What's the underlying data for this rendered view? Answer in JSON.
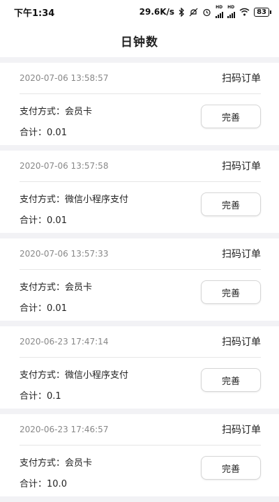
{
  "status_bar": {
    "time": "下午1:34",
    "net_speed": "29.6K/s",
    "battery": "83",
    "hd1": "HD",
    "hd2": "HD"
  },
  "header": {
    "title": "日钟数"
  },
  "orders": [
    {
      "time": "2020-07-06 13:58:57",
      "type": "扫码订单",
      "pay_label": "支付方式：",
      "pay_method": "会员卡",
      "total_label": "合计：",
      "total": "0.01",
      "action": "完善"
    },
    {
      "time": "2020-07-06 13:57:58",
      "type": "扫码订单",
      "pay_label": "支付方式：",
      "pay_method": "微信小程序支付",
      "total_label": "合计：",
      "total": "0.01",
      "action": "完善"
    },
    {
      "time": "2020-07-06 13:57:33",
      "type": "扫码订单",
      "pay_label": "支付方式：",
      "pay_method": "会员卡",
      "total_label": "合计：",
      "total": "0.01",
      "action": "完善"
    },
    {
      "time": "2020-06-23 17:47:14",
      "type": "扫码订单",
      "pay_label": "支付方式：",
      "pay_method": "微信小程序支付",
      "total_label": "合计：",
      "total": "0.1",
      "action": "完善"
    },
    {
      "time": "2020-06-23 17:46:57",
      "type": "扫码订单",
      "pay_label": "支付方式：",
      "pay_method": "会员卡",
      "total_label": "合计：",
      "total": "10.0",
      "action": "完善"
    }
  ]
}
